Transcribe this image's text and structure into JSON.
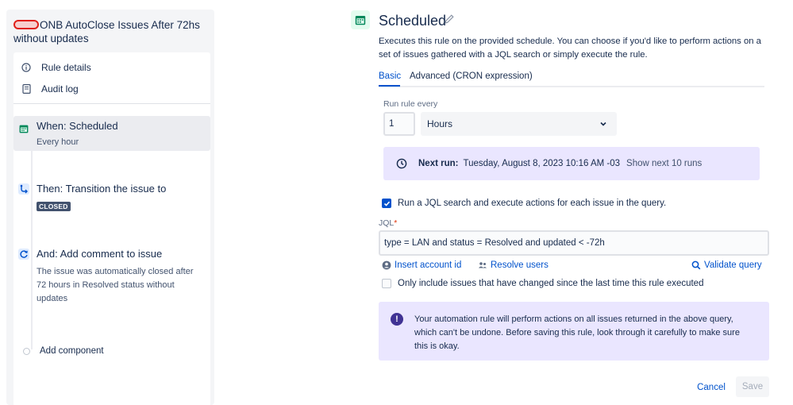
{
  "rule": {
    "title": "ONB AutoClose Issues After 72hs without updates"
  },
  "sidebar": {
    "rule_details": "Rule details",
    "audit_log": "Audit log",
    "steps": [
      {
        "title": "When: Scheduled",
        "subtitle": "Every hour"
      },
      {
        "title": "Then: Transition the issue to",
        "badge": "CLOSED"
      },
      {
        "title": "And: Add comment to issue",
        "subtitle": "The issue was automatically closed after 72 hours in Resolved status without updates"
      }
    ],
    "add_component": "Add component"
  },
  "trigger": {
    "title": "Scheduled",
    "description": "Executes this rule on the provided schedule. You can choose if you'd like to perform actions on a set of issues gathered with a JQL search or simply execute the rule.",
    "tabs": [
      "Basic",
      "Advanced (CRON expression)"
    ],
    "active_tab": "Basic",
    "run_rule_every_label": "Run rule every",
    "interval_value": "1",
    "interval_unit": "Hours",
    "next_run_label": "Next run:",
    "next_run_value": "Tuesday, August 8, 2023 10:16 AM -03",
    "show_next_runs": "Show next 10 runs",
    "jql_checkbox_label": "Run a JQL search and execute actions for each issue in the query.",
    "jql_checkbox_checked": true,
    "jql_label": "JQL",
    "jql_required_mark": "*",
    "jql_value": "type = LAN and status = Resolved and updated < -72h",
    "insert_account_id": "Insert account id",
    "resolve_users": "Resolve users",
    "validate_query": "Validate query",
    "only_changed_label": "Only include issues that have changed since the last time this rule executed",
    "only_changed_checked": false,
    "warning": "Your automation rule will perform actions on all issues returned in the above query, which can't be undone. Before saving this rule, look through it carefully to make sure this is okay.",
    "warning_icon": "!"
  },
  "actions": {
    "cancel": "Cancel",
    "save": "Save"
  },
  "colors": {
    "accent": "#0052cc",
    "info_bg": "#eae6ff",
    "trigger_icon": "#00875a"
  }
}
